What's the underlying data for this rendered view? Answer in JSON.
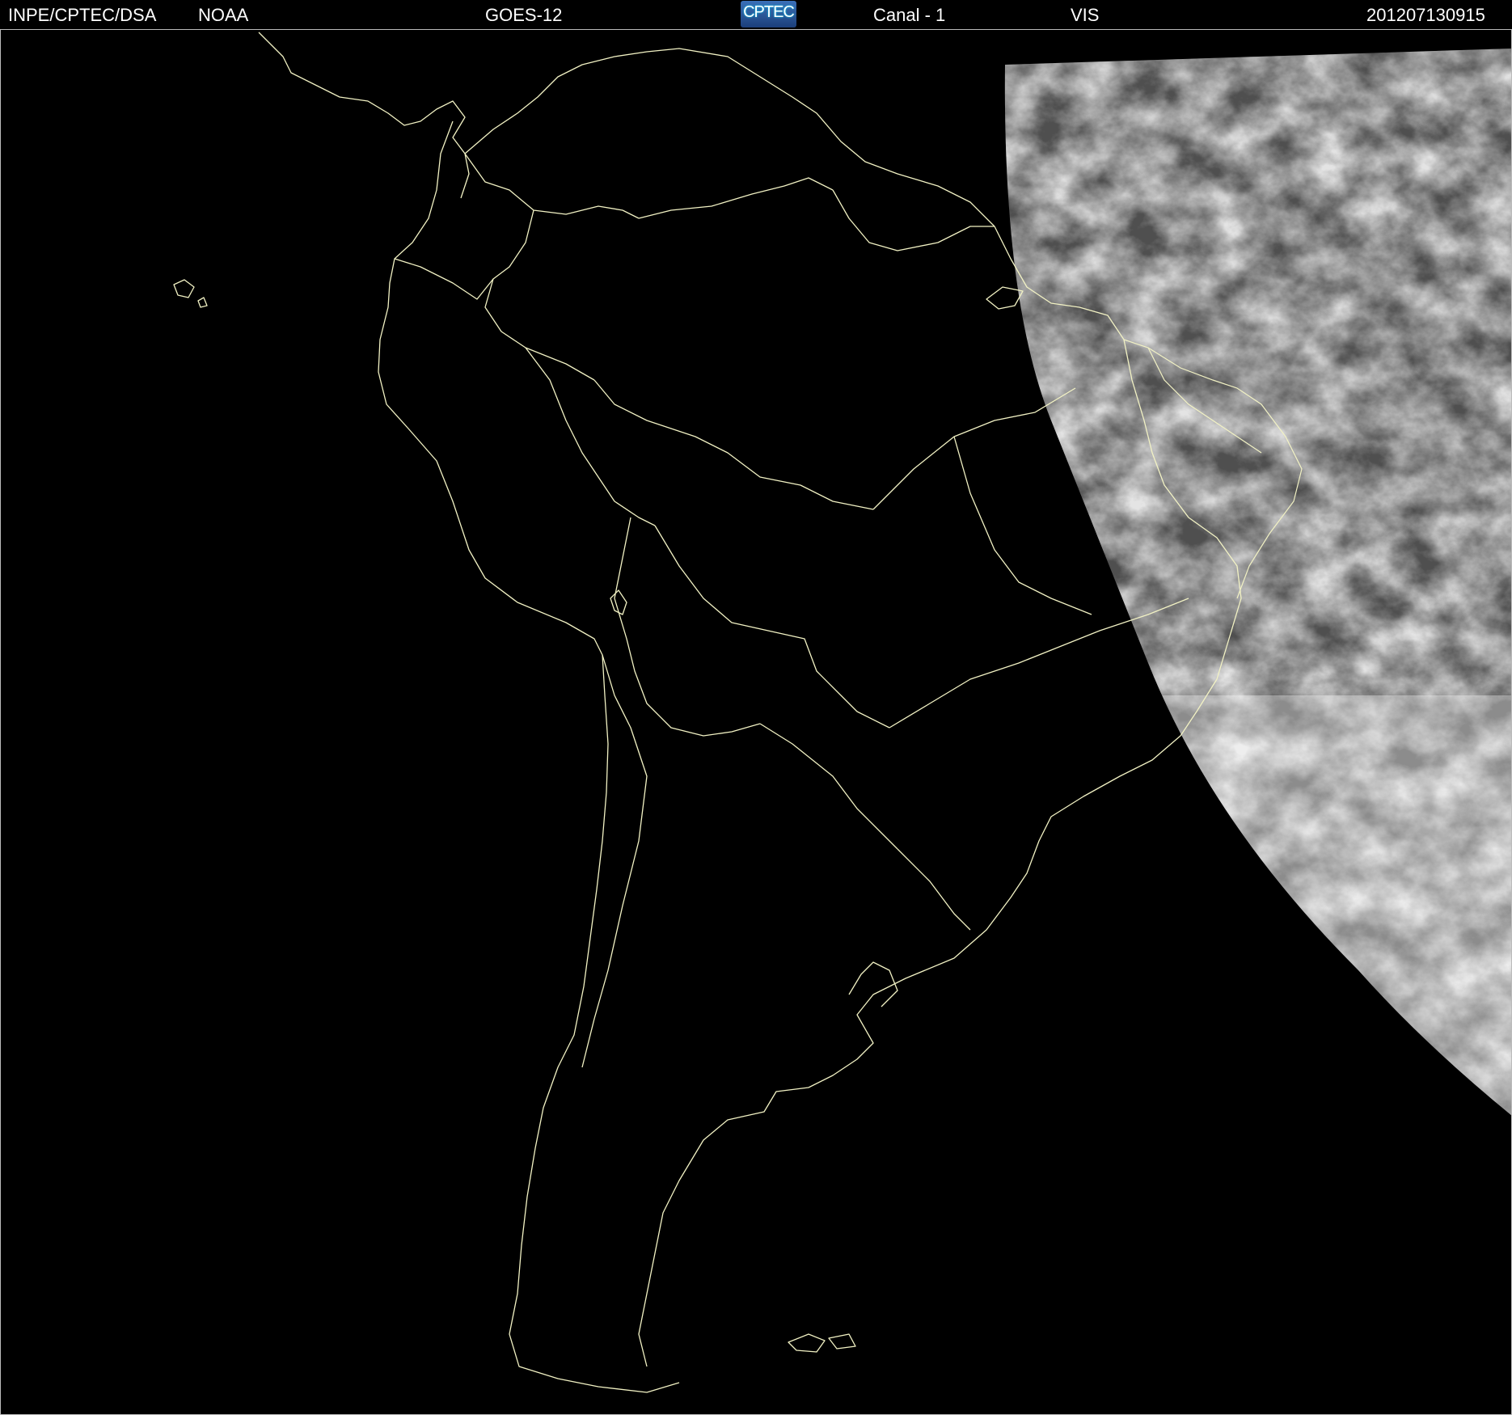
{
  "header": {
    "org": "INPE/CPTEC/DSA",
    "agency": "NOAA",
    "satellite": "GOES-12",
    "logo_text": "CPTEC",
    "channel": "Canal - 1",
    "band": "VIS",
    "timestamp": "201207130915"
  },
  "colors": {
    "background": "#000000",
    "coastline": "#f2f2c4",
    "header_text": "#ffffff",
    "logo_bg": "#2a5aa0"
  },
  "map": {
    "projection": "satellite full-disk crop, South America",
    "illumination": "daylight visible imagery only on the eastern edge (morning terminator)"
  }
}
